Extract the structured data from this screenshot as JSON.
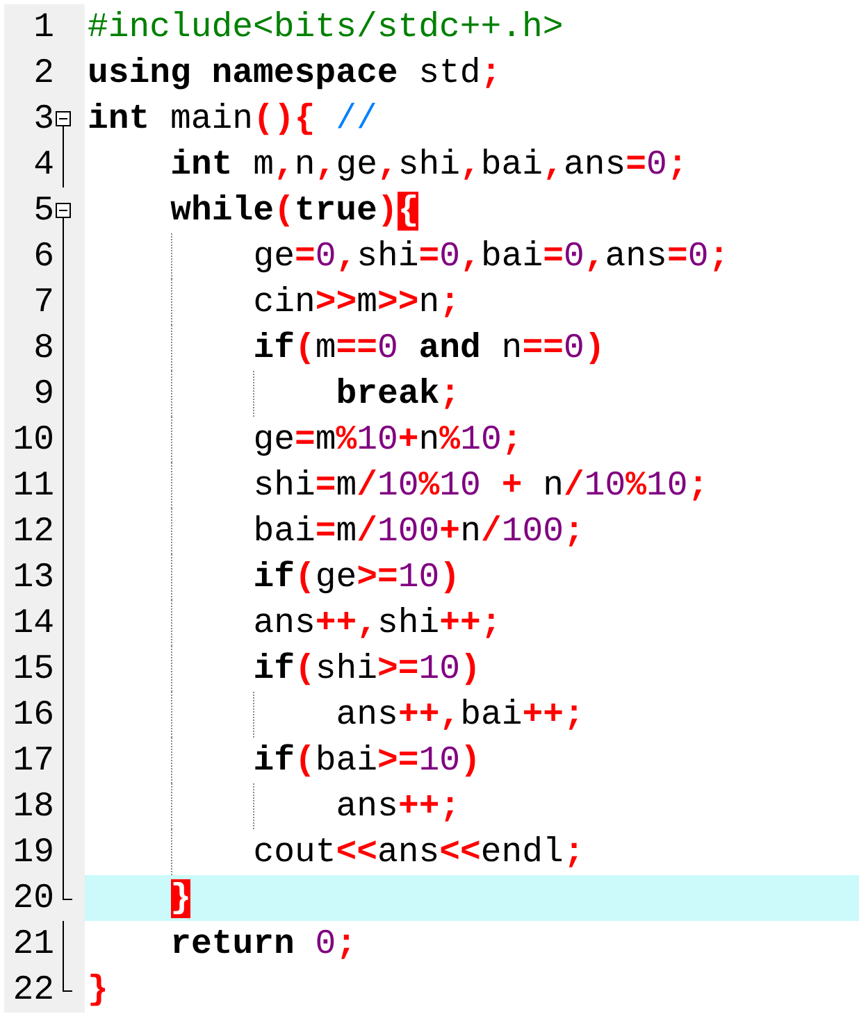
{
  "editor": {
    "lines": [
      {
        "number": "1",
        "highlighted": false,
        "tokens": [
          {
            "kind": "pre",
            "text": "#include<bits/stdc++.h>"
          }
        ]
      },
      {
        "number": "2",
        "highlighted": false,
        "tokens": [
          {
            "kind": "kw",
            "text": "using namespace"
          },
          {
            "kind": "id",
            "text": " std"
          },
          {
            "kind": "op",
            "text": ";"
          }
        ]
      },
      {
        "number": "3",
        "highlighted": false,
        "fold": {
          "kind": "open"
        },
        "tokens": [
          {
            "kind": "kw",
            "text": "int"
          },
          {
            "kind": "id",
            "text": " main"
          },
          {
            "kind": "op",
            "text": "(){"
          },
          {
            "kind": "comment",
            "text": " //"
          }
        ],
        "children": [
          {
            "number": "4",
            "highlighted": false,
            "fold": {
              "kind": "line"
            },
            "tokens": [
              {
                "kind": "kw",
                "text": "int"
              },
              {
                "kind": "id",
                "text": " m"
              },
              {
                "kind": "op",
                "text": ","
              },
              {
                "kind": "id",
                "text": "n"
              },
              {
                "kind": "op",
                "text": ","
              },
              {
                "kind": "id",
                "text": "ge"
              },
              {
                "kind": "op",
                "text": ","
              },
              {
                "kind": "id",
                "text": "shi"
              },
              {
                "kind": "op",
                "text": ","
              },
              {
                "kind": "id",
                "text": "bai"
              },
              {
                "kind": "op",
                "text": ","
              },
              {
                "kind": "id",
                "text": "ans"
              },
              {
                "kind": "op",
                "text": "="
              },
              {
                "kind": "num",
                "text": "0"
              },
              {
                "kind": "op",
                "text": ";"
              }
            ]
          },
          {
            "number": "5",
            "highlighted": false,
            "fold": {
              "kind": "open"
            },
            "tokens": [
              {
                "kind": "kw",
                "text": "while"
              },
              {
                "kind": "op",
                "text": "("
              },
              {
                "kind": "kw",
                "text": "true"
              },
              {
                "kind": "op",
                "text": ")"
              },
              {
                "kind": "match",
                "text": "{"
              }
            ],
            "children": [
              {
                "number": "6",
                "highlighted": false,
                "fold": {
                  "kind": "line"
                },
                "tokens": [
                  {
                    "kind": "id",
                    "text": "ge"
                  },
                  {
                    "kind": "op",
                    "text": "="
                  },
                  {
                    "kind": "num",
                    "text": "0"
                  },
                  {
                    "kind": "op",
                    "text": ","
                  },
                  {
                    "kind": "id",
                    "text": "shi"
                  },
                  {
                    "kind": "op",
                    "text": "="
                  },
                  {
                    "kind": "num",
                    "text": "0"
                  },
                  {
                    "kind": "op",
                    "text": ","
                  },
                  {
                    "kind": "id",
                    "text": "bai"
                  },
                  {
                    "kind": "op",
                    "text": "="
                  },
                  {
                    "kind": "num",
                    "text": "0"
                  },
                  {
                    "kind": "op",
                    "text": ","
                  },
                  {
                    "kind": "id",
                    "text": "ans"
                  },
                  {
                    "kind": "op",
                    "text": "="
                  },
                  {
                    "kind": "num",
                    "text": "0"
                  },
                  {
                    "kind": "op",
                    "text": ";"
                  }
                ]
              },
              {
                "number": "7",
                "highlighted": false,
                "fold": {
                  "kind": "line"
                },
                "tokens": [
                  {
                    "kind": "id",
                    "text": "cin"
                  },
                  {
                    "kind": "op",
                    "text": ">>"
                  },
                  {
                    "kind": "id",
                    "text": "m"
                  },
                  {
                    "kind": "op",
                    "text": ">>"
                  },
                  {
                    "kind": "id",
                    "text": "n"
                  },
                  {
                    "kind": "op",
                    "text": ";"
                  }
                ]
              },
              {
                "number": "8",
                "highlighted": false,
                "fold": {
                  "kind": "line"
                },
                "tokens": [
                  {
                    "kind": "kw",
                    "text": "if"
                  },
                  {
                    "kind": "op",
                    "text": "("
                  },
                  {
                    "kind": "id",
                    "text": "m"
                  },
                  {
                    "kind": "op",
                    "text": "=="
                  },
                  {
                    "kind": "num",
                    "text": "0"
                  },
                  {
                    "kind": "kw",
                    "text": " and"
                  },
                  {
                    "kind": "id",
                    "text": " n"
                  },
                  {
                    "kind": "op",
                    "text": "=="
                  },
                  {
                    "kind": "num",
                    "text": "0"
                  },
                  {
                    "kind": "op",
                    "text": ")"
                  }
                ],
                "children": [
                  {
                    "number": "9",
                    "highlighted": false,
                    "fold": {
                      "kind": "line"
                    },
                    "tokens": [
                      {
                        "kind": "kw",
                        "text": "break"
                      },
                      {
                        "kind": "op",
                        "text": ";"
                      }
                    ]
                  }
                ]
              },
              {
                "number": "10",
                "highlighted": false,
                "fold": {
                  "kind": "line"
                },
                "tokens": [
                  {
                    "kind": "id",
                    "text": "ge"
                  },
                  {
                    "kind": "op",
                    "text": "="
                  },
                  {
                    "kind": "id",
                    "text": "m"
                  },
                  {
                    "kind": "op",
                    "text": "%"
                  },
                  {
                    "kind": "num",
                    "text": "10"
                  },
                  {
                    "kind": "op",
                    "text": "+"
                  },
                  {
                    "kind": "id",
                    "text": "n"
                  },
                  {
                    "kind": "op",
                    "text": "%"
                  },
                  {
                    "kind": "num",
                    "text": "10"
                  },
                  {
                    "kind": "op",
                    "text": ";"
                  }
                ]
              },
              {
                "number": "11",
                "highlighted": false,
                "fold": {
                  "kind": "line"
                },
                "tokens": [
                  {
                    "kind": "id",
                    "text": "shi"
                  },
                  {
                    "kind": "op",
                    "text": "="
                  },
                  {
                    "kind": "id",
                    "text": "m"
                  },
                  {
                    "kind": "op",
                    "text": "/"
                  },
                  {
                    "kind": "num",
                    "text": "10"
                  },
                  {
                    "kind": "op",
                    "text": "%"
                  },
                  {
                    "kind": "num",
                    "text": "10"
                  },
                  {
                    "kind": "op",
                    "text": " + "
                  },
                  {
                    "kind": "id",
                    "text": "n"
                  },
                  {
                    "kind": "op",
                    "text": "/"
                  },
                  {
                    "kind": "num",
                    "text": "10"
                  },
                  {
                    "kind": "op",
                    "text": "%"
                  },
                  {
                    "kind": "num",
                    "text": "10"
                  },
                  {
                    "kind": "op",
                    "text": ";"
                  }
                ]
              },
              {
                "number": "12",
                "highlighted": false,
                "fold": {
                  "kind": "line"
                },
                "tokens": [
                  {
                    "kind": "id",
                    "text": "bai"
                  },
                  {
                    "kind": "op",
                    "text": "="
                  },
                  {
                    "kind": "id",
                    "text": "m"
                  },
                  {
                    "kind": "op",
                    "text": "/"
                  },
                  {
                    "kind": "num",
                    "text": "100"
                  },
                  {
                    "kind": "op",
                    "text": "+"
                  },
                  {
                    "kind": "id",
                    "text": "n"
                  },
                  {
                    "kind": "op",
                    "text": "/"
                  },
                  {
                    "kind": "num",
                    "text": "100"
                  },
                  {
                    "kind": "op",
                    "text": ";"
                  }
                ]
              },
              {
                "number": "13",
                "highlighted": false,
                "fold": {
                  "kind": "line"
                },
                "tokens": [
                  {
                    "kind": "kw",
                    "text": "if"
                  },
                  {
                    "kind": "op",
                    "text": "("
                  },
                  {
                    "kind": "id",
                    "text": "ge"
                  },
                  {
                    "kind": "op",
                    "text": ">="
                  },
                  {
                    "kind": "num",
                    "text": "10"
                  },
                  {
                    "kind": "op",
                    "text": ")"
                  }
                ]
              },
              {
                "number": "14",
                "highlighted": false,
                "fold": {
                  "kind": "line"
                },
                "tokens": [
                  {
                    "kind": "id",
                    "text": "ans"
                  },
                  {
                    "kind": "op",
                    "text": "++,"
                  },
                  {
                    "kind": "id",
                    "text": "shi"
                  },
                  {
                    "kind": "op",
                    "text": "++;"
                  }
                ]
              },
              {
                "number": "15",
                "highlighted": false,
                "fold": {
                  "kind": "line"
                },
                "tokens": [
                  {
                    "kind": "kw",
                    "text": "if"
                  },
                  {
                    "kind": "op",
                    "text": "("
                  },
                  {
                    "kind": "id",
                    "text": "shi"
                  },
                  {
                    "kind": "op",
                    "text": ">="
                  },
                  {
                    "kind": "num",
                    "text": "10"
                  },
                  {
                    "kind": "op",
                    "text": ")"
                  }
                ],
                "children": [
                  {
                    "number": "16",
                    "highlighted": false,
                    "fold": {
                      "kind": "line"
                    },
                    "tokens": [
                      {
                        "kind": "id",
                        "text": "ans"
                      },
                      {
                        "kind": "op",
                        "text": "++,"
                      },
                      {
                        "kind": "id",
                        "text": "bai"
                      },
                      {
                        "kind": "op",
                        "text": "++;"
                      }
                    ]
                  }
                ]
              },
              {
                "number": "17",
                "highlighted": false,
                "fold": {
                  "kind": "line"
                },
                "tokens": [
                  {
                    "kind": "kw",
                    "text": "if"
                  },
                  {
                    "kind": "op",
                    "text": "("
                  },
                  {
                    "kind": "id",
                    "text": "bai"
                  },
                  {
                    "kind": "op",
                    "text": ">="
                  },
                  {
                    "kind": "num",
                    "text": "10"
                  },
                  {
                    "kind": "op",
                    "text": ")"
                  }
                ],
                "children": [
                  {
                    "number": "18",
                    "highlighted": false,
                    "fold": {
                      "kind": "line"
                    },
                    "tokens": [
                      {
                        "kind": "id",
                        "text": "ans"
                      },
                      {
                        "kind": "op",
                        "text": "++;"
                      }
                    ]
                  }
                ]
              },
              {
                "number": "19",
                "highlighted": false,
                "fold": {
                  "kind": "line"
                },
                "tokens": [
                  {
                    "kind": "id",
                    "text": "cout"
                  },
                  {
                    "kind": "op",
                    "text": "<<"
                  },
                  {
                    "kind": "id",
                    "text": "ans"
                  },
                  {
                    "kind": "op",
                    "text": "<<"
                  },
                  {
                    "kind": "id",
                    "text": "endl"
                  },
                  {
                    "kind": "op",
                    "text": ";"
                  }
                ]
              }
            ]
          },
          {
            "number": "20",
            "highlighted": true,
            "fold": {
              "kind": "end"
            },
            "tokens": [
              {
                "kind": "match",
                "text": "}"
              }
            ]
          },
          {
            "number": "21",
            "highlighted": false,
            "fold": {
              "kind": "line"
            },
            "tokens": [
              {
                "kind": "kw",
                "text": "return"
              },
              {
                "kind": "num",
                "text": " 0"
              },
              {
                "kind": "op",
                "text": ";"
              }
            ]
          }
        ]
      },
      {
        "number": "22",
        "highlighted": false,
        "fold": {
          "kind": "end"
        },
        "tokens": [
          {
            "kind": "op",
            "text": "}"
          }
        ]
      }
    ]
  }
}
